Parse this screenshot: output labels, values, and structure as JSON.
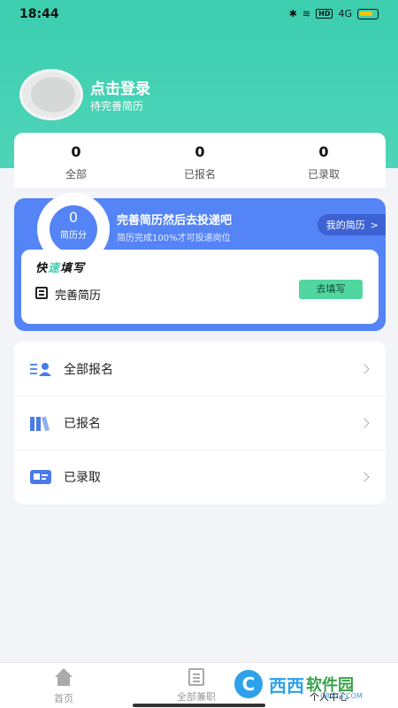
{
  "status_bar": {
    "time": "18:44",
    "hd": "HD",
    "signal": "4G"
  },
  "profile": {
    "login_title": "点击登录",
    "subtitle": "待完善简历"
  },
  "stats": [
    {
      "value": "0",
      "label": "全部"
    },
    {
      "value": "0",
      "label": "已报名"
    },
    {
      "value": "0",
      "label": "已录取"
    }
  ],
  "resume": {
    "score": "0",
    "score_label": "简历分",
    "title": "完善简历然后去投递吧",
    "subtitle": "简历完成100%才可投递岗位",
    "my_resume_label": "我的简历",
    "quick_title_a": "快",
    "quick_title_accent": "速",
    "quick_title_b": "填写",
    "quick_item_label": "完善简历",
    "fill_button": "去填写"
  },
  "menu": [
    {
      "label": "全部报名",
      "icon": "list-user-icon"
    },
    {
      "label": "已报名",
      "icon": "books-icon"
    },
    {
      "label": "已录取",
      "icon": "id-card-icon"
    }
  ],
  "tabbar": [
    {
      "label": "首页",
      "icon": "home-icon"
    },
    {
      "label": "全部兼职",
      "icon": "doc-icon"
    },
    {
      "label": "个人中心",
      "icon": "user-icon"
    }
  ],
  "watermark": {
    "logo": "C",
    "text1": "西西",
    "text2": "软件园",
    "sub": "CR173.COM"
  },
  "colors": {
    "header": "#3ecfb0",
    "resume_card": "#5484f5",
    "fill_button": "#52d6a0"
  }
}
